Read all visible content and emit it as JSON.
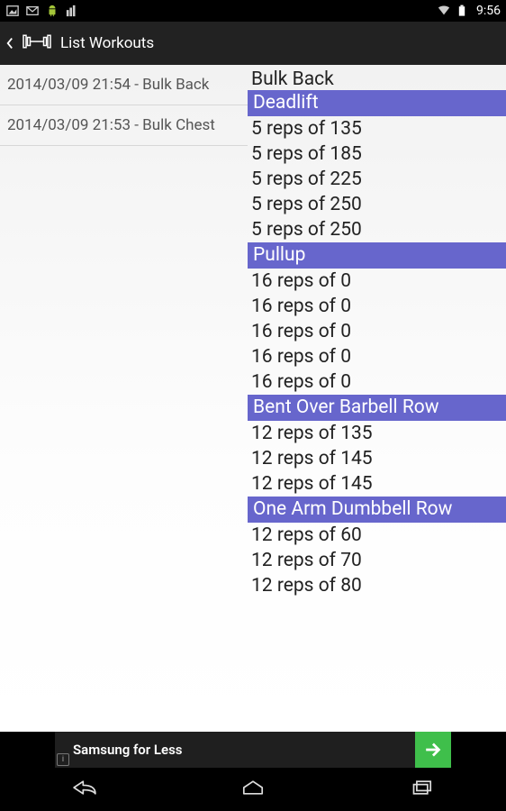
{
  "statusbar": {
    "clock": "9:56"
  },
  "actionbar": {
    "title": "List Workouts"
  },
  "workouts_list": {
    "items": [
      {
        "label": "2014/03/09 21:54 - Bulk Back"
      },
      {
        "label": "2014/03/09 21:53 - Bulk Chest"
      }
    ]
  },
  "detail": {
    "title": "Bulk Back",
    "exercises": [
      {
        "name": "Deadlift",
        "sets": [
          "5 reps of 135",
          "5 reps of 185",
          "5 reps of 225",
          "5 reps of 250",
          "5 reps of 250"
        ]
      },
      {
        "name": "Pullup",
        "sets": [
          "16 reps of 0",
          "16 reps of 0",
          "16 reps of 0",
          "16 reps of 0",
          "16 reps of 0"
        ]
      },
      {
        "name": "Bent Over Barbell Row",
        "sets": [
          "12 reps of 135",
          "12 reps of 145",
          "12 reps of 145"
        ]
      },
      {
        "name": "One Arm Dumbbell Row",
        "sets": [
          "12 reps of 60",
          "12 reps of 70",
          "12 reps of 80"
        ]
      }
    ]
  },
  "ad": {
    "text": "Samsung for Less"
  },
  "colors": {
    "accent": "#6766cc"
  }
}
